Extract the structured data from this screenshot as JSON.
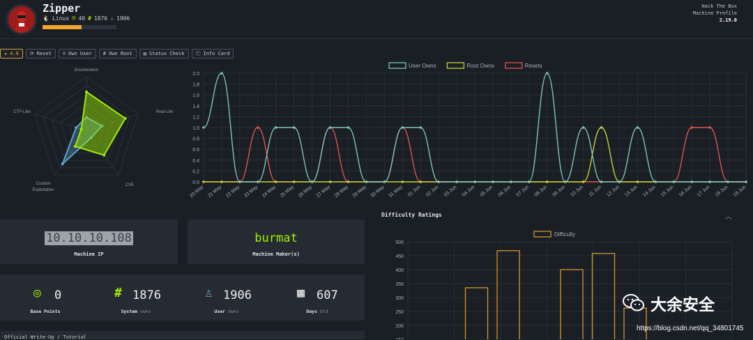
{
  "machine": {
    "name": "Zipper",
    "os": "Linux",
    "points": "40",
    "system_owns": "1876",
    "user_owns": "1906",
    "progress": 0.53
  },
  "htb": {
    "line1": "Hack The Box",
    "line2": "Machine Profile",
    "version": "2.19.0"
  },
  "toolbar": [
    {
      "name": "rating-button",
      "icon": "star-icon",
      "glyph": "★",
      "label": "4.0"
    },
    {
      "name": "reset-button",
      "icon": "reset-icon",
      "glyph": "⟳",
      "label": "Reset"
    },
    {
      "name": "own-user-button",
      "icon": "user-icon",
      "glyph": "☺",
      "label": "Own User"
    },
    {
      "name": "own-root-button",
      "icon": "hash-icon",
      "glyph": "#",
      "label": "Own Root"
    },
    {
      "name": "status-check-button",
      "icon": "status-icon",
      "glyph": "▤",
      "label": "Status Check"
    },
    {
      "name": "info-card-button",
      "icon": "info-icon",
      "glyph": "ⓘ",
      "label": "Info Card"
    }
  ],
  "radar": {
    "labels": [
      "Enumeration",
      "Real-Life",
      "CVE",
      "Custom\nExploitation",
      "CTF-Like"
    ],
    "green": [
      0.72,
      0.75,
      0.55,
      0.35,
      0.1
    ],
    "blue": [
      0.25,
      0.3,
      0.15,
      0.75,
      0.2
    ],
    "colors": {
      "green": "#9fef00",
      "blue": "#5ea1c9"
    }
  },
  "chart_data": [
    {
      "type": "line",
      "x": [
        "20 May",
        "21 May",
        "22 May",
        "23 May",
        "24 May",
        "25 May",
        "26 May",
        "27 May",
        "28 May",
        "29 May",
        "30 May",
        "31 May",
        "01 Jun",
        "02 Jun",
        "03 Jun",
        "04 Jun",
        "05 Jun",
        "06 Jun",
        "07 Jun",
        "08 Jun",
        "09 Jun",
        "10 Jun",
        "11 Jun",
        "12 Jun",
        "13 Jun",
        "14 Jun",
        "15 Jun",
        "16 Jun",
        "17 Jun",
        "18 Jun",
        "19 Jun"
      ],
      "series": [
        {
          "name": "User Owns",
          "color": "#7ec4b8",
          "values": [
            1,
            2,
            0,
            0,
            1,
            1,
            0,
            1,
            1,
            0,
            0,
            1,
            1,
            0,
            0,
            0,
            0,
            0,
            0,
            2,
            0,
            1,
            0,
            0,
            1,
            0,
            0,
            0,
            0,
            0,
            0
          ]
        },
        {
          "name": "Root Owns",
          "color": "#c7d234",
          "values": [
            0,
            0,
            0,
            0,
            0,
            0,
            0,
            0,
            0,
            0,
            0,
            0,
            0,
            0,
            0,
            0,
            0,
            0,
            0,
            0,
            0,
            0,
            1,
            0,
            0,
            0,
            0,
            0,
            0,
            0,
            0
          ]
        },
        {
          "name": "Resets",
          "color": "#e0534f",
          "values": [
            0,
            0,
            0,
            1,
            0,
            0,
            0,
            1,
            0,
            0,
            0,
            1,
            0,
            0,
            0,
            0,
            0,
            0,
            0,
            0,
            0,
            0,
            0,
            0,
            0,
            0,
            0,
            1,
            1,
            0,
            0
          ]
        }
      ],
      "ylim": [
        0,
        2
      ]
    },
    {
      "type": "bar",
      "title": "Difficulty Ratings",
      "series": [
        {
          "name": "Difficulty",
          "color": "#d8962f",
          "values": [
            10,
            335,
            468,
            140,
            400,
            458,
            262
          ]
        }
      ],
      "ylim": [
        0,
        500
      ]
    }
  ],
  "panels": {
    "ip": {
      "value": "10.10.10.108",
      "label": "Machine IP"
    },
    "maker": {
      "value": "burmat",
      "label": "Machine Maker(s)"
    }
  },
  "stats": [
    {
      "name": "base-points",
      "icon": "target-icon",
      "value": "0",
      "label": "Base Points",
      "sub": ""
    },
    {
      "name": "system-owns",
      "icon": "hash-icon",
      "value": "1876",
      "label": "System",
      "sub": "owns"
    },
    {
      "name": "user-owns",
      "icon": "user-icon",
      "value": "1906",
      "label": "User",
      "sub": "Owns"
    },
    {
      "name": "days-old",
      "icon": "calendar-icon",
      "value": "607",
      "label": "Days",
      "sub": "Old"
    }
  ],
  "writeup": {
    "label": "Official Write-Up / Tutorial"
  },
  "difficulty": {
    "title": "Difficulty Ratings"
  },
  "watermark": {
    "text": "大余安全",
    "url": "https://blog.csdn.net/qq_34801745"
  }
}
